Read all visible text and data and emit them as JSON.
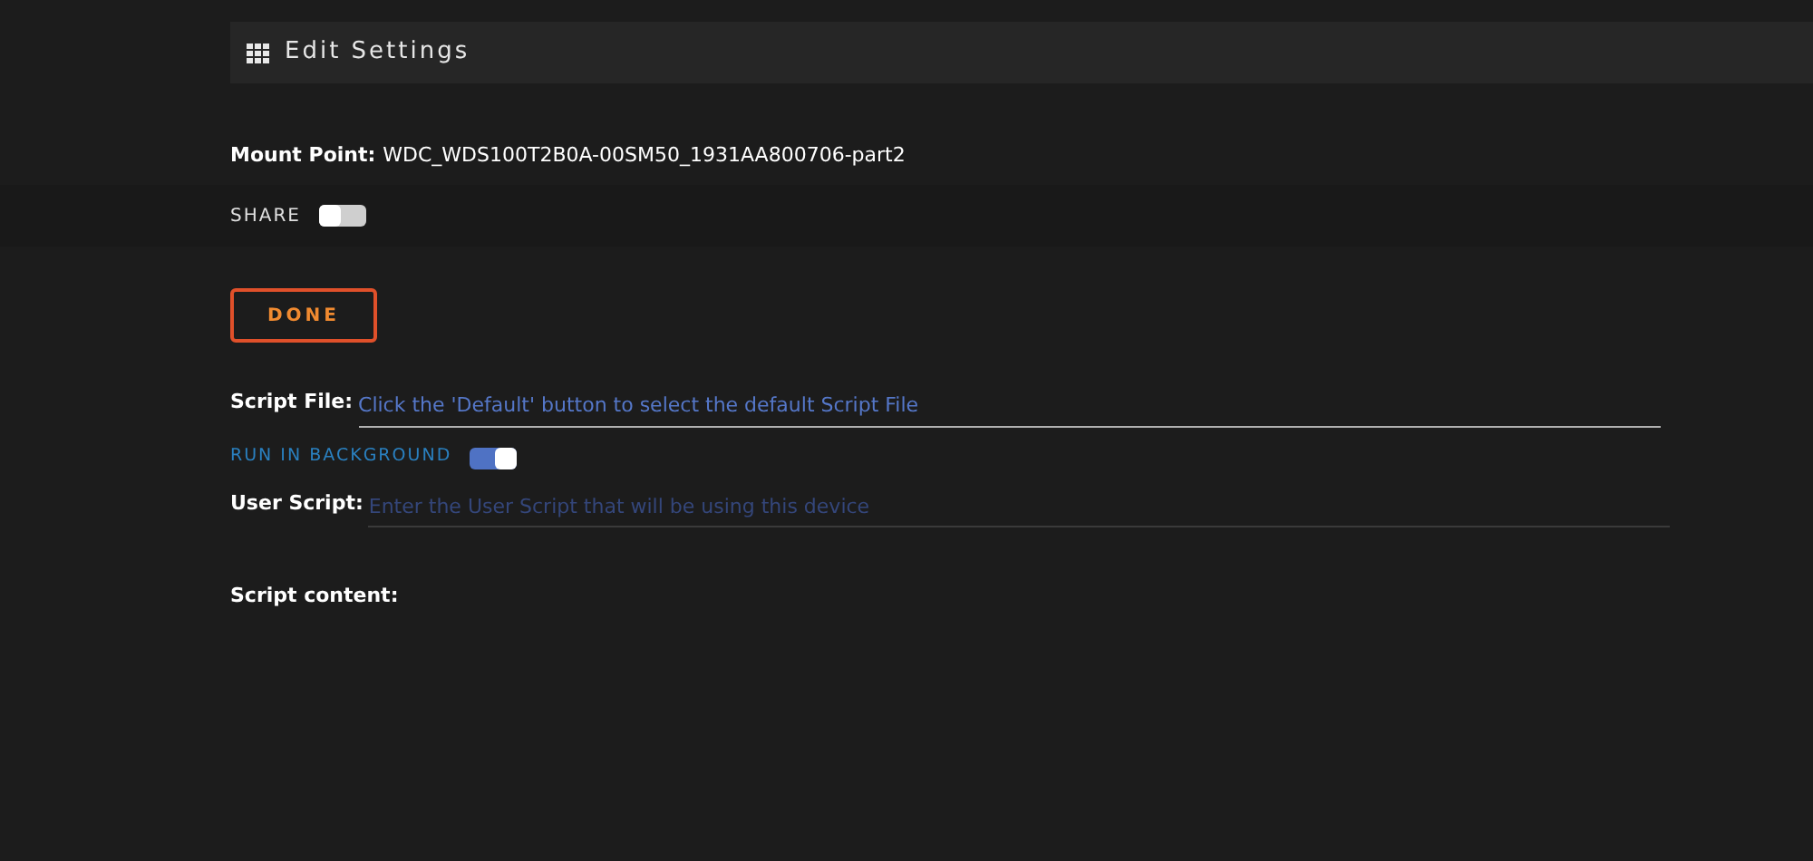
{
  "header": {
    "title": "Edit Settings"
  },
  "mount_point": {
    "label": "Mount Point:",
    "value": "WDC_WDS100T2B0A-00SM50_1931AA800706-part2"
  },
  "share": {
    "label": "SHARE",
    "on": false
  },
  "done_button": {
    "label": "DONE"
  },
  "script_file": {
    "label": "Script File:",
    "value": "Click the 'Default' button to select the default Script File"
  },
  "run_in_background": {
    "label": "RUN IN BACKGROUND",
    "on": true
  },
  "user_script": {
    "label": "User Script:",
    "placeholder": "Enter the User Script that will be using this device"
  },
  "script_content": {
    "label": "Script content:"
  }
}
